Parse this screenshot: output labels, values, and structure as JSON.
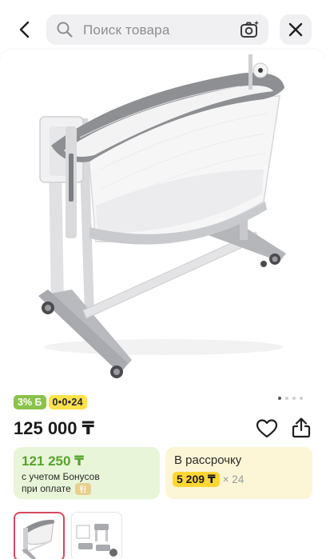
{
  "header": {
    "search_placeholder": "Поиск товара"
  },
  "gallery": {
    "image_count": 4,
    "active_index": 0
  },
  "badges": {
    "bonus": "3% Б",
    "installment": "0•0•24"
  },
  "product": {
    "price": "125 000 ₸"
  },
  "bonus_offer": {
    "price": "121 250 ₸",
    "note_line1": "с учетом Бонусов",
    "note_line2": "при оплате"
  },
  "installment_offer": {
    "title": "В рассрочку",
    "amount": "5 209 ₸",
    "multiplier": "× 24"
  },
  "thumbnails": [
    {
      "name": "bedside-crib-photo"
    },
    {
      "name": "bedside-crib-variants"
    }
  ],
  "colors": {
    "bonus_green": "#8bc34a",
    "installment_yellow": "#ffe14d",
    "active_thumb_border": "#d64a5a"
  }
}
